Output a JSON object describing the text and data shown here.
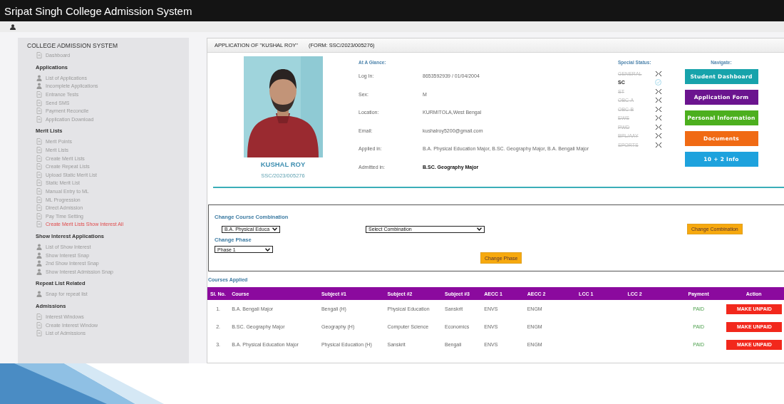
{
  "window": {
    "title": "Sripat Singh College Admission System"
  },
  "sidebar": {
    "title": "COLLEGE ADMISSION SYSTEM",
    "sections": [
      {
        "items": [
          {
            "label": "Dashboard",
            "kind": "page",
            "highlighted": false
          }
        ]
      },
      {
        "heading": "Applications",
        "items": [
          {
            "label": "List of Applications",
            "kind": "person",
            "highlighted": false
          },
          {
            "label": "Incomplete Applications",
            "kind": "person",
            "highlighted": false
          },
          {
            "label": "Entrance Tests",
            "kind": "page",
            "highlighted": false
          },
          {
            "label": "Send SMS",
            "kind": "page",
            "highlighted": false
          },
          {
            "label": "Payment Reconcile",
            "kind": "page",
            "highlighted": false
          },
          {
            "label": "Application Download",
            "kind": "page",
            "highlighted": false
          }
        ]
      },
      {
        "heading": "Merit Lists",
        "items": [
          {
            "label": "Merit Points",
            "kind": "page",
            "highlighted": false
          },
          {
            "label": "Merit Lists",
            "kind": "page",
            "highlighted": false
          },
          {
            "label": "Create Merit Lists",
            "kind": "page",
            "highlighted": false
          },
          {
            "label": "Create Repeat Lists",
            "kind": "page",
            "highlighted": false
          },
          {
            "label": "Upload Static Merit List",
            "kind": "page",
            "highlighted": false
          },
          {
            "label": "Static Merit List",
            "kind": "page",
            "highlighted": false
          },
          {
            "label": "Manual Entry to ML",
            "kind": "page",
            "highlighted": false
          },
          {
            "label": "ML Progression",
            "kind": "page",
            "highlighted": false
          },
          {
            "label": "Direct Admission",
            "kind": "page",
            "highlighted": false
          },
          {
            "label": "Pay Time Setting",
            "kind": "page",
            "highlighted": false
          },
          {
            "label": "Create Merit Lists Show Interest All",
            "kind": "page",
            "highlighted": true
          }
        ]
      },
      {
        "heading": "Show Interest Applications",
        "items": [
          {
            "label": "List of Show Interest",
            "kind": "person",
            "highlighted": false
          },
          {
            "label": "Show Interest Snap",
            "kind": "person",
            "highlighted": false
          },
          {
            "label": "2nd Show Interest Snap",
            "kind": "person",
            "highlighted": false
          },
          {
            "label": "Show Interest Admission Snap",
            "kind": "person",
            "highlighted": false
          }
        ]
      },
      {
        "heading": "Repeat List Related",
        "items": [
          {
            "label": "Snap for repeat list",
            "kind": "person",
            "highlighted": false
          }
        ]
      },
      {
        "heading": "Admissions",
        "items": [
          {
            "label": "Interest Windows",
            "kind": "page",
            "highlighted": false
          },
          {
            "label": "Create Interest Window",
            "kind": "page",
            "highlighted": false
          },
          {
            "label": "List of Admissions",
            "kind": "page",
            "highlighted": false
          }
        ]
      }
    ]
  },
  "panel": {
    "title": "APPLICATION OF \"KUSHAL ROY\"",
    "form": "(FORM: SSC/2023/005276)"
  },
  "profile": {
    "name": "KUSHAL ROY",
    "form_no": "SSC/2023/005276"
  },
  "glance": {
    "heading": "At A Glance:",
    "fields": [
      {
        "label": "Log In:",
        "value": "8653592939 / 01/04/2004",
        "bold": false
      },
      {
        "label": "Sex:",
        "value": "M",
        "bold": false
      },
      {
        "label": "Location:",
        "value": "KURMITOLA,West Bengal",
        "bold": false
      },
      {
        "label": "Email:",
        "value": "kushalroy5200@gmail.com",
        "bold": false
      },
      {
        "label": "Applied in:",
        "value": "B.A. Physical Education Major, B.SC. Geography Major, B.A. Bengali Major",
        "bold": false
      },
      {
        "label": "Admitted in:",
        "value": "B.SC. Geography Major",
        "bold": true
      }
    ]
  },
  "special_status": {
    "heading": "Special Status:",
    "items": [
      {
        "label": "GENERAL",
        "applicable": false
      },
      {
        "label": "SC",
        "applicable": true
      },
      {
        "label": "ST",
        "applicable": false
      },
      {
        "label": "OBC-A",
        "applicable": false
      },
      {
        "label": "OBC-B",
        "applicable": false
      },
      {
        "label": "EWS",
        "applicable": false
      },
      {
        "label": "PWD",
        "applicable": false
      },
      {
        "label": "BPL/AAY",
        "applicable": false
      },
      {
        "label": "SPORTS",
        "applicable": false
      }
    ]
  },
  "navigate": {
    "heading": "Navigate:",
    "buttons": [
      {
        "label": "Student Dashboard",
        "color": "#17a3ab"
      },
      {
        "label": "Application Form",
        "color": "#6b148f"
      },
      {
        "label": "Personal Information",
        "color": "#4caf1e"
      },
      {
        "label": "Documents",
        "color": "#f06a14"
      },
      {
        "label": "10 + 2 Info",
        "color": "#1ea2dd"
      }
    ]
  },
  "change_course": {
    "heading": "Change Course Combination",
    "course_select": "B.A. Physical Educa",
    "combination_select": "Select Combination",
    "button": "Change Combination"
  },
  "change_phase": {
    "heading": "Change Phase",
    "phase_select": "Phase 1",
    "button": "Change Phase"
  },
  "courses": {
    "heading": "Courses Applied",
    "columns": [
      "Sl. No.",
      "Course",
      "Subject #1",
      "Subject #2",
      "Subject #3",
      "AECC 1",
      "AECC 2",
      "LCC 1",
      "LCC 2",
      "Payment",
      "Action"
    ],
    "rows": [
      {
        "cells": [
          "1.",
          "B.A. Bengali Major",
          "Bengali (H)",
          "Physical Education",
          "Sanskrit",
          "ENVS",
          "ENGM"
        ],
        "payment": "PAID",
        "action": "MAKE UNPAID"
      },
      {
        "cells": [
          "2.",
          "B.SC. Geography Major",
          "Geography (H)",
          "Computer Science",
          "Economics",
          "ENVS",
          "ENGM"
        ],
        "payment": "PAID",
        "action": "MAKE UNPAID"
      },
      {
        "cells": [
          "3.",
          "B.A. Physical Education Major",
          "Physical Education (H)",
          "Sanskrit",
          "Bengali",
          "ENVS",
          "ENGM"
        ],
        "payment": "PAID",
        "action": "MAKE UNPAID"
      }
    ]
  }
}
